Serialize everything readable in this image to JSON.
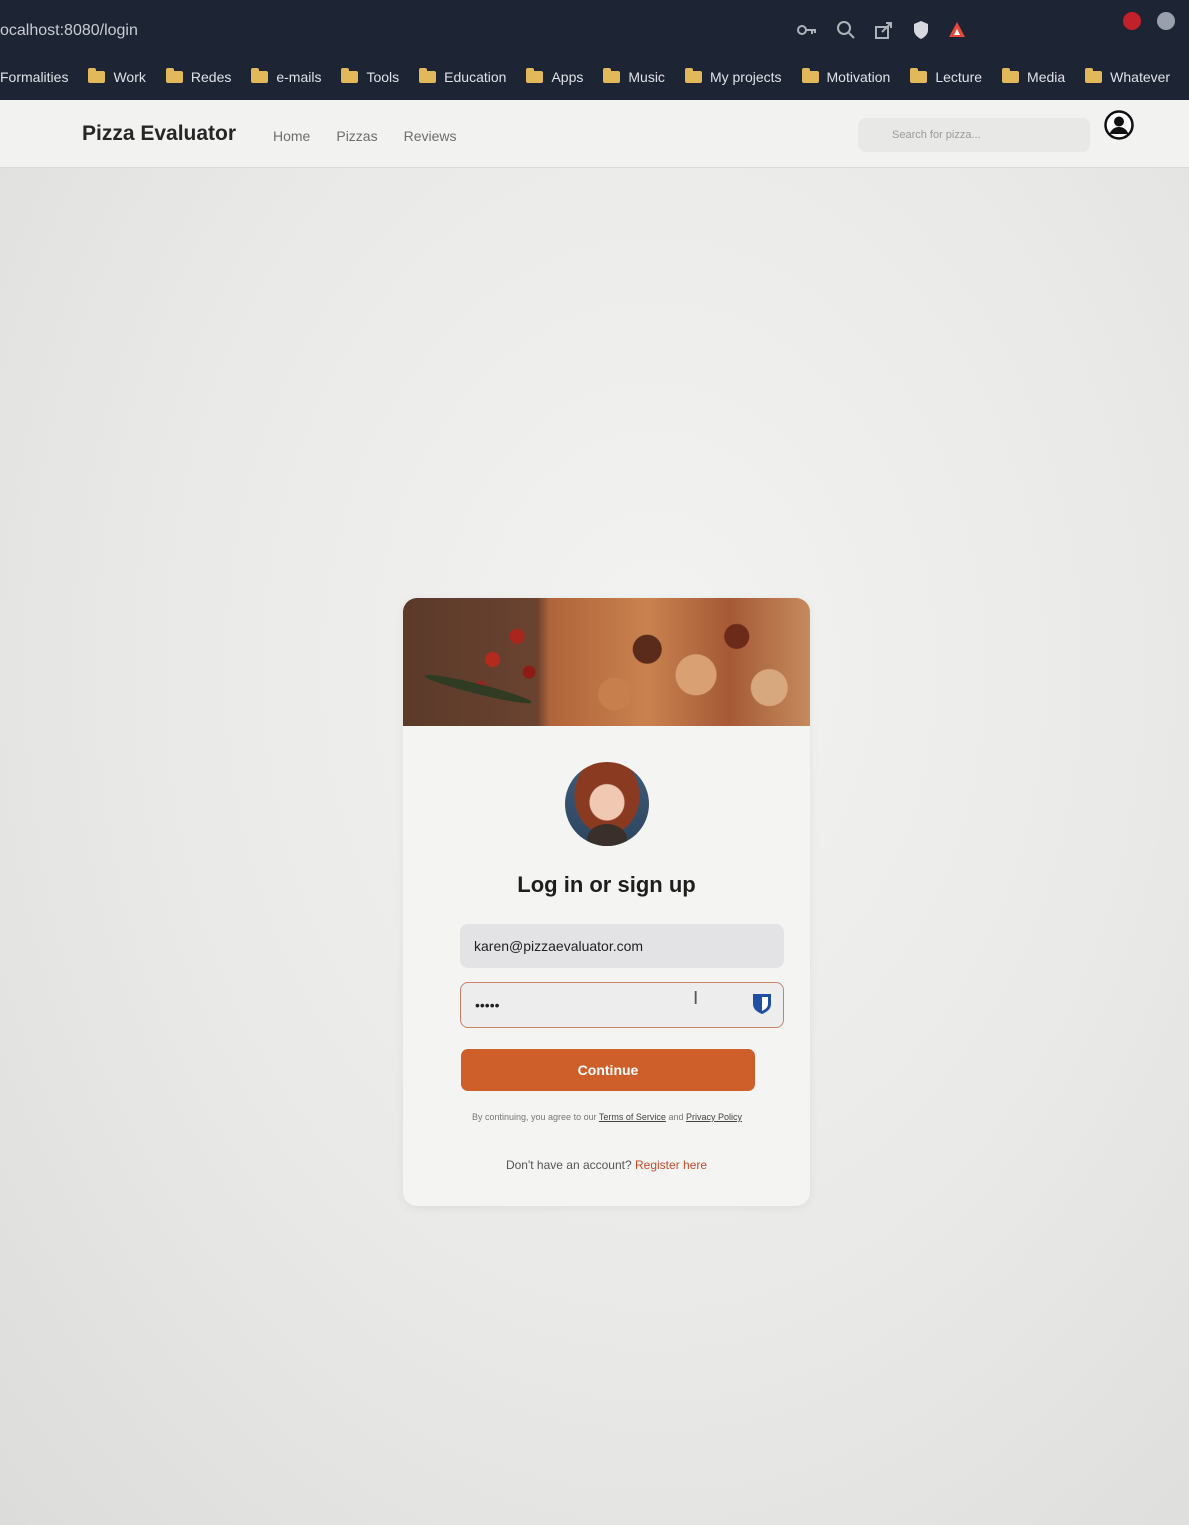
{
  "browser": {
    "url": "ocalhost:8080/login",
    "bookmarks": [
      {
        "label": "Formalities",
        "folder": false
      },
      {
        "label": "Work",
        "folder": true
      },
      {
        "label": "Redes",
        "folder": true
      },
      {
        "label": "e-mails",
        "folder": true
      },
      {
        "label": "Tools",
        "folder": true
      },
      {
        "label": "Education",
        "folder": true
      },
      {
        "label": "Apps",
        "folder": true
      },
      {
        "label": "Music",
        "folder": true
      },
      {
        "label": "My projects",
        "folder": true
      },
      {
        "label": "Motivation",
        "folder": true
      },
      {
        "label": "Lecture",
        "folder": true
      },
      {
        "label": "Media",
        "folder": true
      },
      {
        "label": "Whatever",
        "folder": true
      }
    ],
    "toolbar_icons": [
      "key-icon",
      "zoom-icon",
      "share-icon",
      "brave-shield-icon",
      "brave-rewards-icon"
    ]
  },
  "navbar": {
    "brand": "Pizza Evaluator",
    "links": [
      "Home",
      "Pizzas",
      "Reviews"
    ],
    "search_placeholder": "Search for pizza...",
    "account_icon": "user-circle-icon"
  },
  "login": {
    "title": "Log in or sign up",
    "email_value": "karen@pizzaevaluator.com",
    "password_value": "•••••",
    "continue_label": "Continue",
    "terms_prefix": "By continuing, you agree to our ",
    "terms_link": "Terms of Service",
    "terms_and": " and ",
    "privacy_link": "Privacy Policy",
    "register_prompt": "Don't have an account? ",
    "register_link": "Register here"
  },
  "colors": {
    "accent": "#cf5f2a",
    "link": "#c44a2a",
    "chrome": "#1d2433"
  }
}
